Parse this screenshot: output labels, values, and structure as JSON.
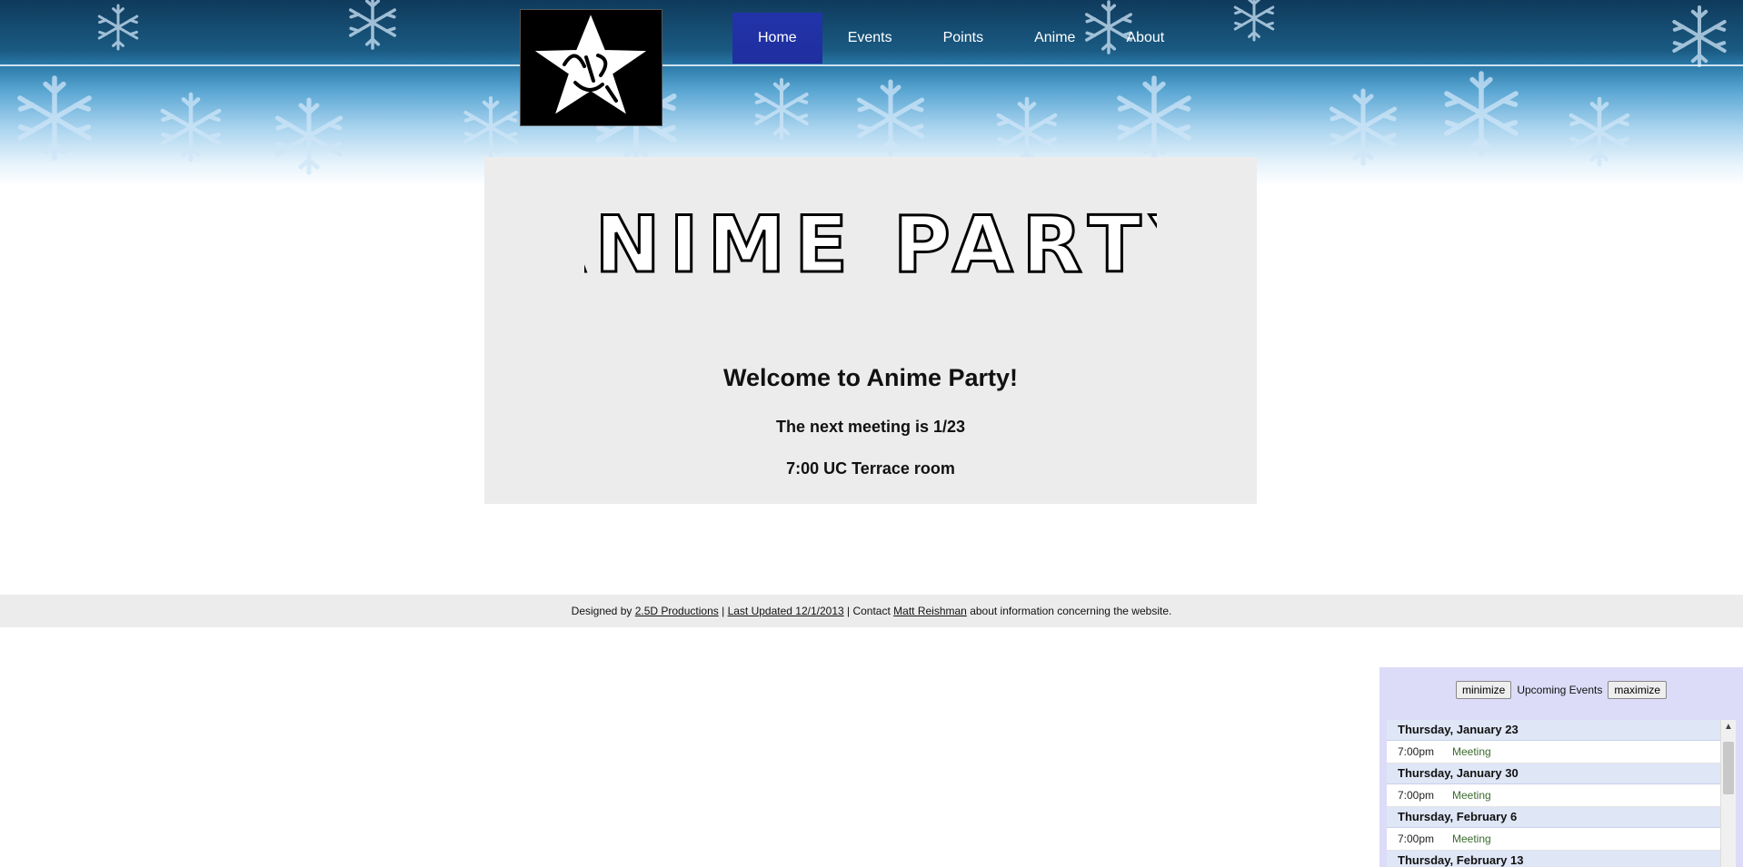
{
  "header": {
    "logo_alt": "Anime Party",
    "nav": [
      {
        "label": "Home",
        "active": true
      },
      {
        "label": "Events"
      },
      {
        "label": "Points"
      },
      {
        "label": "Anime"
      },
      {
        "label": "About"
      }
    ]
  },
  "main": {
    "title_art": "ANIME PARTY",
    "welcome": "Welcome to Anime Party!",
    "next_meeting": "The next meeting is 1/23",
    "location": "7:00 UC Terrace room"
  },
  "footer": {
    "designed_by_prefix": "Designed by ",
    "designer_link": "2.5D Productions",
    "sep1": " | ",
    "updated_link": "Last Updated 12/1/2013",
    "sep2": " | Contact ",
    "contact_link": "Matt Reishman",
    "suffix": " about information concerning the website."
  },
  "widget": {
    "minimize_label": "minimize",
    "title": "Upcoming Events",
    "maximize_label": "maximize",
    "days": [
      {
        "date": "Thursday, January 23",
        "time": "7:00pm",
        "event": "Meeting"
      },
      {
        "date": "Thursday, January 30",
        "time": "7:00pm",
        "event": "Meeting"
      },
      {
        "date": "Thursday, February 6",
        "time": "7:00pm",
        "event": "Meeting"
      },
      {
        "date": "Thursday, February 13",
        "time": "",
        "event": ""
      }
    ]
  },
  "colors": {
    "nav_active": "#2233aa",
    "card_bg": "#ececec",
    "widget_bg": "#dcdcf8",
    "event_name": "#3b6b2e"
  }
}
